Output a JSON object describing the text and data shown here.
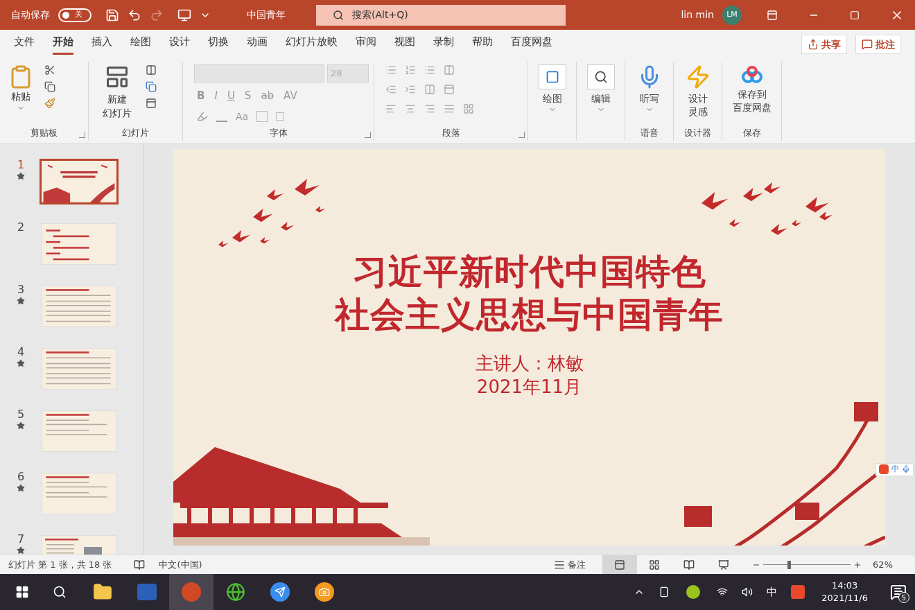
{
  "title_bar": {
    "autosave_label": "自动保存",
    "autosave_toggle": {
      "label": "关",
      "on": false
    },
    "doc_title": "中国青年",
    "search": {
      "placeholder": "搜索(Alt+Q)"
    },
    "user_name": "lin min",
    "avatar": "LM"
  },
  "menu_tabs": [
    {
      "label": "文件",
      "selected": false
    },
    {
      "label": "开始",
      "selected": true
    },
    {
      "label": "插入",
      "selected": false
    },
    {
      "label": "绘图",
      "selected": false
    },
    {
      "label": "设计",
      "selected": false
    },
    {
      "label": "切换",
      "selected": false
    },
    {
      "label": "动画",
      "selected": false
    },
    {
      "label": "幻灯片放映",
      "selected": false
    },
    {
      "label": "审阅",
      "selected": false
    },
    {
      "label": "视图",
      "selected": false
    },
    {
      "label": "录制",
      "selected": false
    },
    {
      "label": "帮助",
      "selected": false
    },
    {
      "label": "百度网盘",
      "selected": false
    }
  ],
  "share_button": "共享",
  "comments_button": "批注",
  "ribbon": {
    "clipboard": {
      "paste": "粘贴",
      "label": "剪贴板"
    },
    "slides": {
      "new_slide": [
        "新建",
        "幻灯片"
      ],
      "label": "幻灯片"
    },
    "font": {
      "size": "28",
      "buttons": [
        "B",
        "I",
        "U",
        "S",
        "ab",
        "AV"
      ],
      "case_button": "Aa",
      "label": "字体"
    },
    "paragraph": {
      "label": "段落"
    },
    "groups": [
      {
        "kind": "draw",
        "lines": [
          "绘图"
        ]
      },
      {
        "kind": "edit",
        "lines": [
          "编辑"
        ]
      },
      {
        "kind": "dictate",
        "lines": [
          "听写"
        ],
        "label": "语音"
      },
      {
        "kind": "designer",
        "lines": [
          "设计",
          "灵感"
        ],
        "label": "设计器"
      },
      {
        "kind": "cloud",
        "lines": [
          "保存到",
          "百度网盘"
        ],
        "label": "保存"
      }
    ]
  },
  "thumbnails": [
    {
      "number": "1",
      "selected": true,
      "animated": true,
      "kind": "title"
    },
    {
      "number": "2",
      "selected": false,
      "animated": false,
      "kind": "outline"
    },
    {
      "number": "3",
      "selected": false,
      "animated": true,
      "kind": "text"
    },
    {
      "number": "4",
      "selected": false,
      "animated": true,
      "kind": "text"
    },
    {
      "number": "5",
      "selected": false,
      "animated": true,
      "kind": "short"
    },
    {
      "number": "6",
      "selected": false,
      "animated": true,
      "kind": "short"
    },
    {
      "number": "7",
      "selected": false,
      "animated": true,
      "kind": "photo"
    }
  ],
  "slide": {
    "title_lines": [
      "习近平新时代中国特色",
      "社会主义思想与中国青年"
    ],
    "presenter": "主讲人：林敏",
    "date": "2021年11月"
  },
  "ime_toolbar": {
    "label": "中"
  },
  "status_bar": {
    "slide_info": "幻灯片 第 1 张，共 18 张",
    "language": "中文(中国)",
    "notes": "备注",
    "views": [
      {
        "kind": "normal",
        "selected": true
      },
      {
        "kind": "sorter",
        "selected": false
      },
      {
        "kind": "reading",
        "selected": false
      },
      {
        "kind": "show",
        "selected": false
      }
    ],
    "zoom": {
      "level": 0.29
    },
    "zoom_reading": "62%"
  },
  "taskbar": {
    "apps": [
      {
        "kind": "explorer",
        "selected": false
      },
      {
        "kind": "word",
        "selected": false
      },
      {
        "kind": "powerpoint",
        "selected": true
      },
      {
        "kind": "browser",
        "selected": false
      },
      {
        "kind": "feishu",
        "selected": false
      },
      {
        "kind": "camera",
        "selected": false
      }
    ],
    "ime": "中",
    "time": "14:03",
    "date": "2021/11/6",
    "notifications": "5"
  }
}
